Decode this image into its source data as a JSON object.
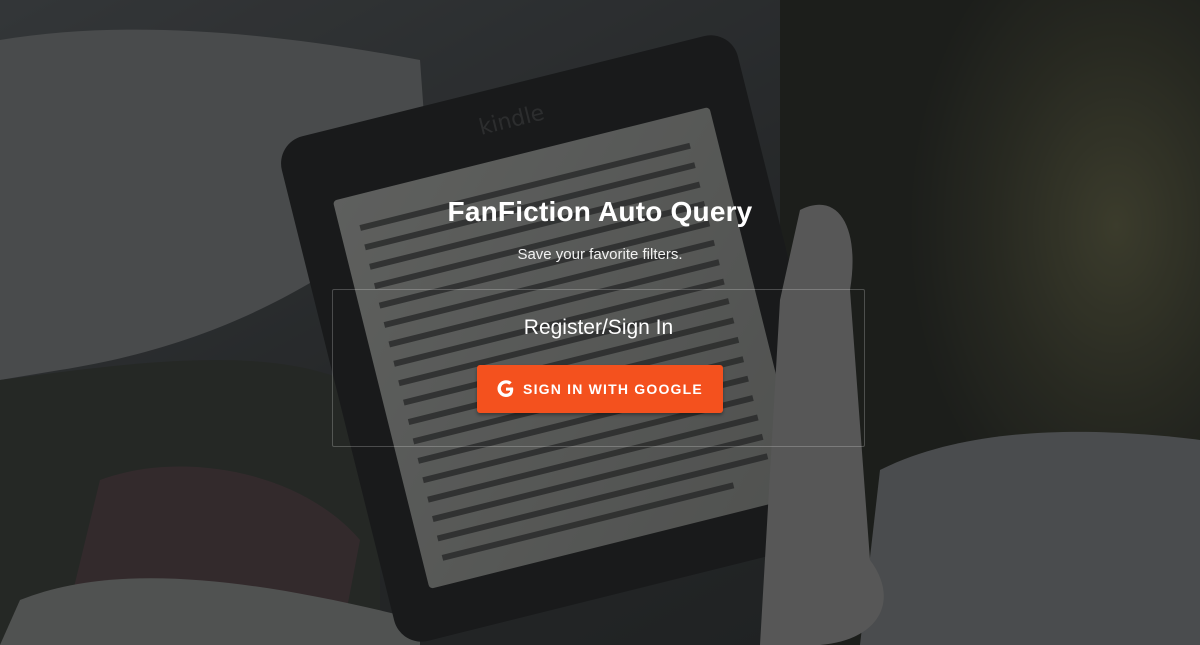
{
  "header": {
    "title": "FanFiction Auto Query",
    "subtitle": "Save your favorite filters."
  },
  "auth_card": {
    "heading": "Register/Sign In",
    "google_button_label": "SIGN IN WITH GOOGLE",
    "google_button_icon": "google-g-icon"
  },
  "colors": {
    "button_accent": "#f4511e",
    "overlay": "#141618"
  },
  "background": {
    "kindle_brand": "kindle"
  }
}
